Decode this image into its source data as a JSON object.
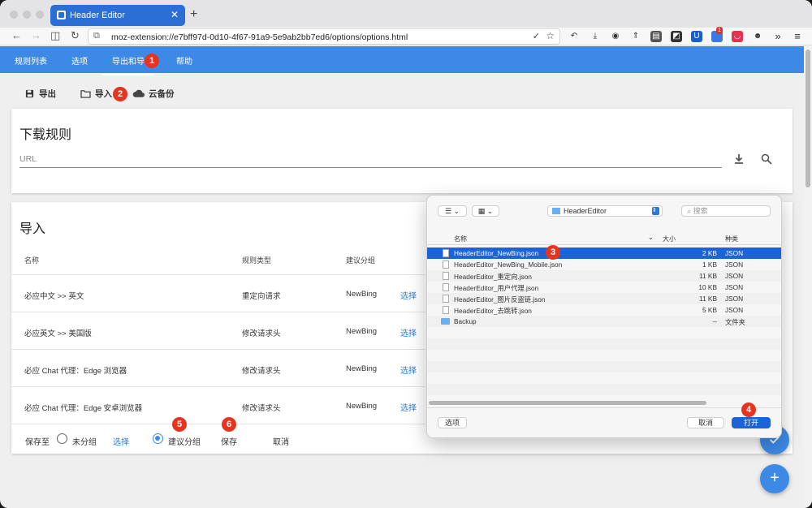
{
  "browser": {
    "tab_title": "Header Editor",
    "url": "moz-extension://e7bff97d-0d10-4f67-91a9-5e9ab2bb7ed6/options/options.html",
    "ext_badge": "1"
  },
  "appbar": {
    "tabs": [
      "规则列表",
      "选项",
      "导出和导",
      "帮助"
    ]
  },
  "toolbar": {
    "export_label": "导出",
    "import_label": "导入",
    "cloud_label": "云备份"
  },
  "download": {
    "title": "下载规则",
    "url_placeholder": "URL"
  },
  "import": {
    "title": "导入",
    "headers": [
      "名称",
      "规则类型",
      "建议分组"
    ],
    "rows": [
      {
        "name": "必应中文 >> 英文",
        "type": "重定向请求",
        "group": "NewBing",
        "action": "选择"
      },
      {
        "name": "必应英文 >> 美国版",
        "type": "修改请求头",
        "group": "NewBing",
        "action": "选择"
      },
      {
        "name": "必应 Chat 代理：Edge 浏览器",
        "type": "修改请求头",
        "group": "NewBing",
        "action": "选择"
      },
      {
        "name": "必应 Chat 代理：Edge 安卓浏览器",
        "type": "修改请求头",
        "group": "NewBing",
        "action": "选择"
      }
    ],
    "save_to": "保存至",
    "ungrouped": "未分组",
    "choose": "选择",
    "suggested": "建议分组",
    "save": "保存",
    "cancel": "取消"
  },
  "dialog": {
    "folder": "HeaderEditor",
    "search_placeholder": "搜索",
    "col_name": "名称",
    "col_size": "大小",
    "col_kind": "种类",
    "files": [
      {
        "name": "HeaderEditor_NewBing.json",
        "size": "2 KB",
        "kind": "JSON"
      },
      {
        "name": "HeaderEditor_NewBing_Mobile.json",
        "size": "1 KB",
        "kind": "JSON"
      },
      {
        "name": "HeaderEditor_重定向.json",
        "size": "11 KB",
        "kind": "JSON"
      },
      {
        "name": "HeaderEditor_用户代理.json",
        "size": "10 KB",
        "kind": "JSON"
      },
      {
        "name": "HeaderEditor_图片反盗链.json",
        "size": "11 KB",
        "kind": "JSON"
      },
      {
        "name": "HeaderEditor_去跳转.json",
        "size": "5 KB",
        "kind": "JSON"
      },
      {
        "name": "Backup",
        "size": "--",
        "kind": "文件夹"
      }
    ],
    "options_btn": "选项",
    "cancel_btn": "取消",
    "open_btn": "打开"
  },
  "badges": [
    "1",
    "2",
    "3",
    "4",
    "5",
    "6"
  ],
  "colors": {
    "accent": "#3d8ae6",
    "selection": "#1d63d8",
    "badge": "#e53520",
    "link": "#2b7bd6"
  }
}
